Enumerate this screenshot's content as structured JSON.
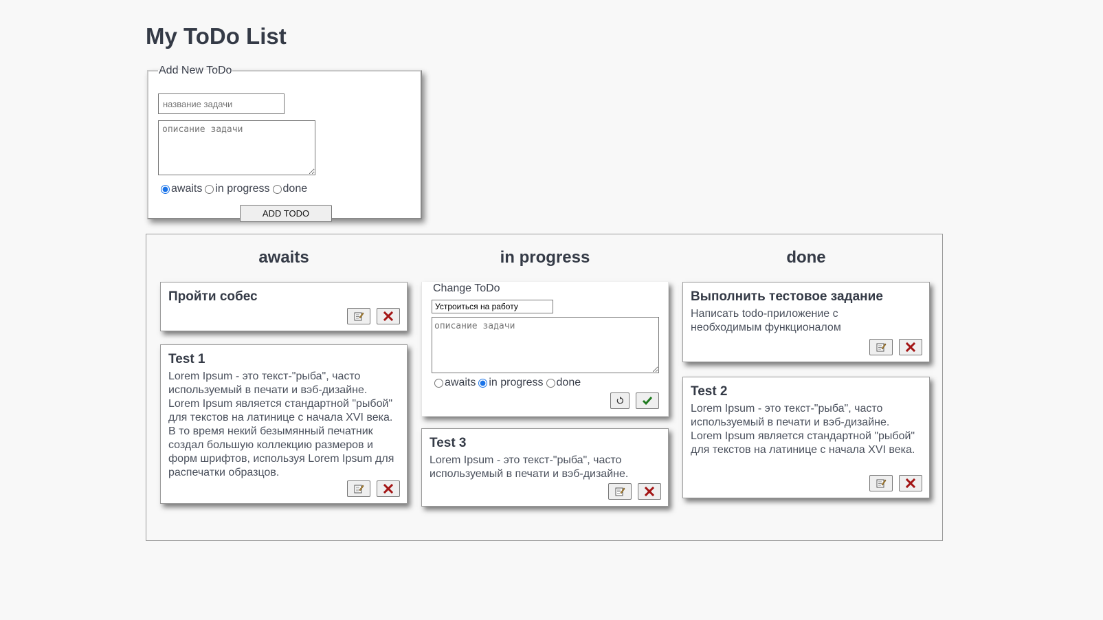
{
  "page": {
    "title": "My ToDo List"
  },
  "add_form": {
    "legend": "Add New ToDo",
    "title_placeholder": "название задачи",
    "description_placeholder": "описание задачи",
    "statuses": [
      {
        "label": "awaits",
        "checked": true
      },
      {
        "label": "in progress",
        "checked": false
      },
      {
        "label": "done",
        "checked": false
      }
    ],
    "submit_label": "ADD TODO"
  },
  "board": {
    "columns": [
      {
        "title": "awaits",
        "cards": [
          {
            "title": "Пройти собес",
            "text": ""
          },
          {
            "title": "Test 1",
            "text": "Lorem Ipsum - это текст-\"рыба\", часто используемый в печати и вэб-дизайне. Lorem Ipsum является стандартной \"рыбой\" для текстов на латинице с начала XVI века. В то время некий безымянный печатник создал большую коллекцию размеров и форм шрифтов, используя Lorem Ipsum для распечатки образцов."
          }
        ]
      },
      {
        "title": "in progress",
        "edit_card": {
          "legend": "Change ToDo",
          "title_value": "Устроиться на работу",
          "description_placeholder": "описание задачи",
          "statuses": [
            {
              "label": "awaits",
              "checked": false
            },
            {
              "label": "in progress",
              "checked": true
            },
            {
              "label": "done",
              "checked": false
            }
          ]
        },
        "cards": [
          {
            "title": "Test 3",
            "text": "Lorem Ipsum - это текст-\"рыба\", часто используемый в печати и вэб-дизайне."
          }
        ]
      },
      {
        "title": "done",
        "cards": [
          {
            "title": "Выполнить тестовое задание",
            "text": "Написать todo-приложение с необходимым функционалом"
          },
          {
            "title": "Test 2",
            "text": "Lorem Ipsum - это текст-\"рыба\", часто используемый в печати и вэб-дизайне. Lorem Ipsum является стандартной \"рыбой\" для текстов на латинице с начала XVI века."
          }
        ]
      }
    ]
  },
  "icons": {
    "edit": "edit-note-icon",
    "delete": "red-x-icon",
    "reset": "undo-icon",
    "save": "green-check-icon"
  },
  "colors": {
    "delete": "#a31515",
    "save": "#1f7a1f",
    "radio_accent": "#1a73e8"
  }
}
